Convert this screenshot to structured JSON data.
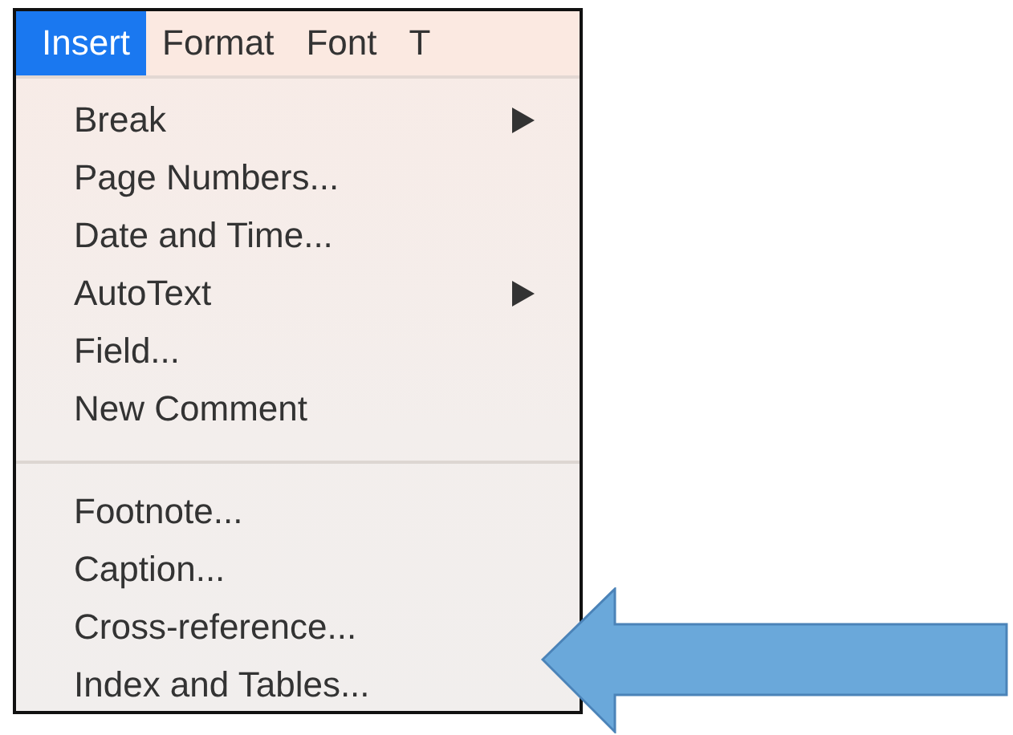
{
  "menu_bar": [
    {
      "label": "Insert",
      "selected": true
    },
    {
      "label": "Format",
      "selected": false
    },
    {
      "label": "Font",
      "selected": false
    },
    {
      "label": "T",
      "selected": false
    }
  ],
  "menu": {
    "groups": [
      [
        {
          "label": "Break",
          "submenu": true
        },
        {
          "label": "Page Numbers...",
          "submenu": false
        },
        {
          "label": "Date and Time...",
          "submenu": false
        },
        {
          "label": "AutoText",
          "submenu": true
        },
        {
          "label": "Field...",
          "submenu": false
        },
        {
          "label": "New Comment",
          "submenu": false
        }
      ],
      [
        {
          "label": "Footnote...",
          "submenu": false
        },
        {
          "label": "Caption...",
          "submenu": false
        },
        {
          "label": "Cross-reference...",
          "submenu": false
        },
        {
          "label": "Index and Tables...",
          "submenu": false
        }
      ]
    ]
  },
  "callout": {
    "kind": "arrow"
  }
}
